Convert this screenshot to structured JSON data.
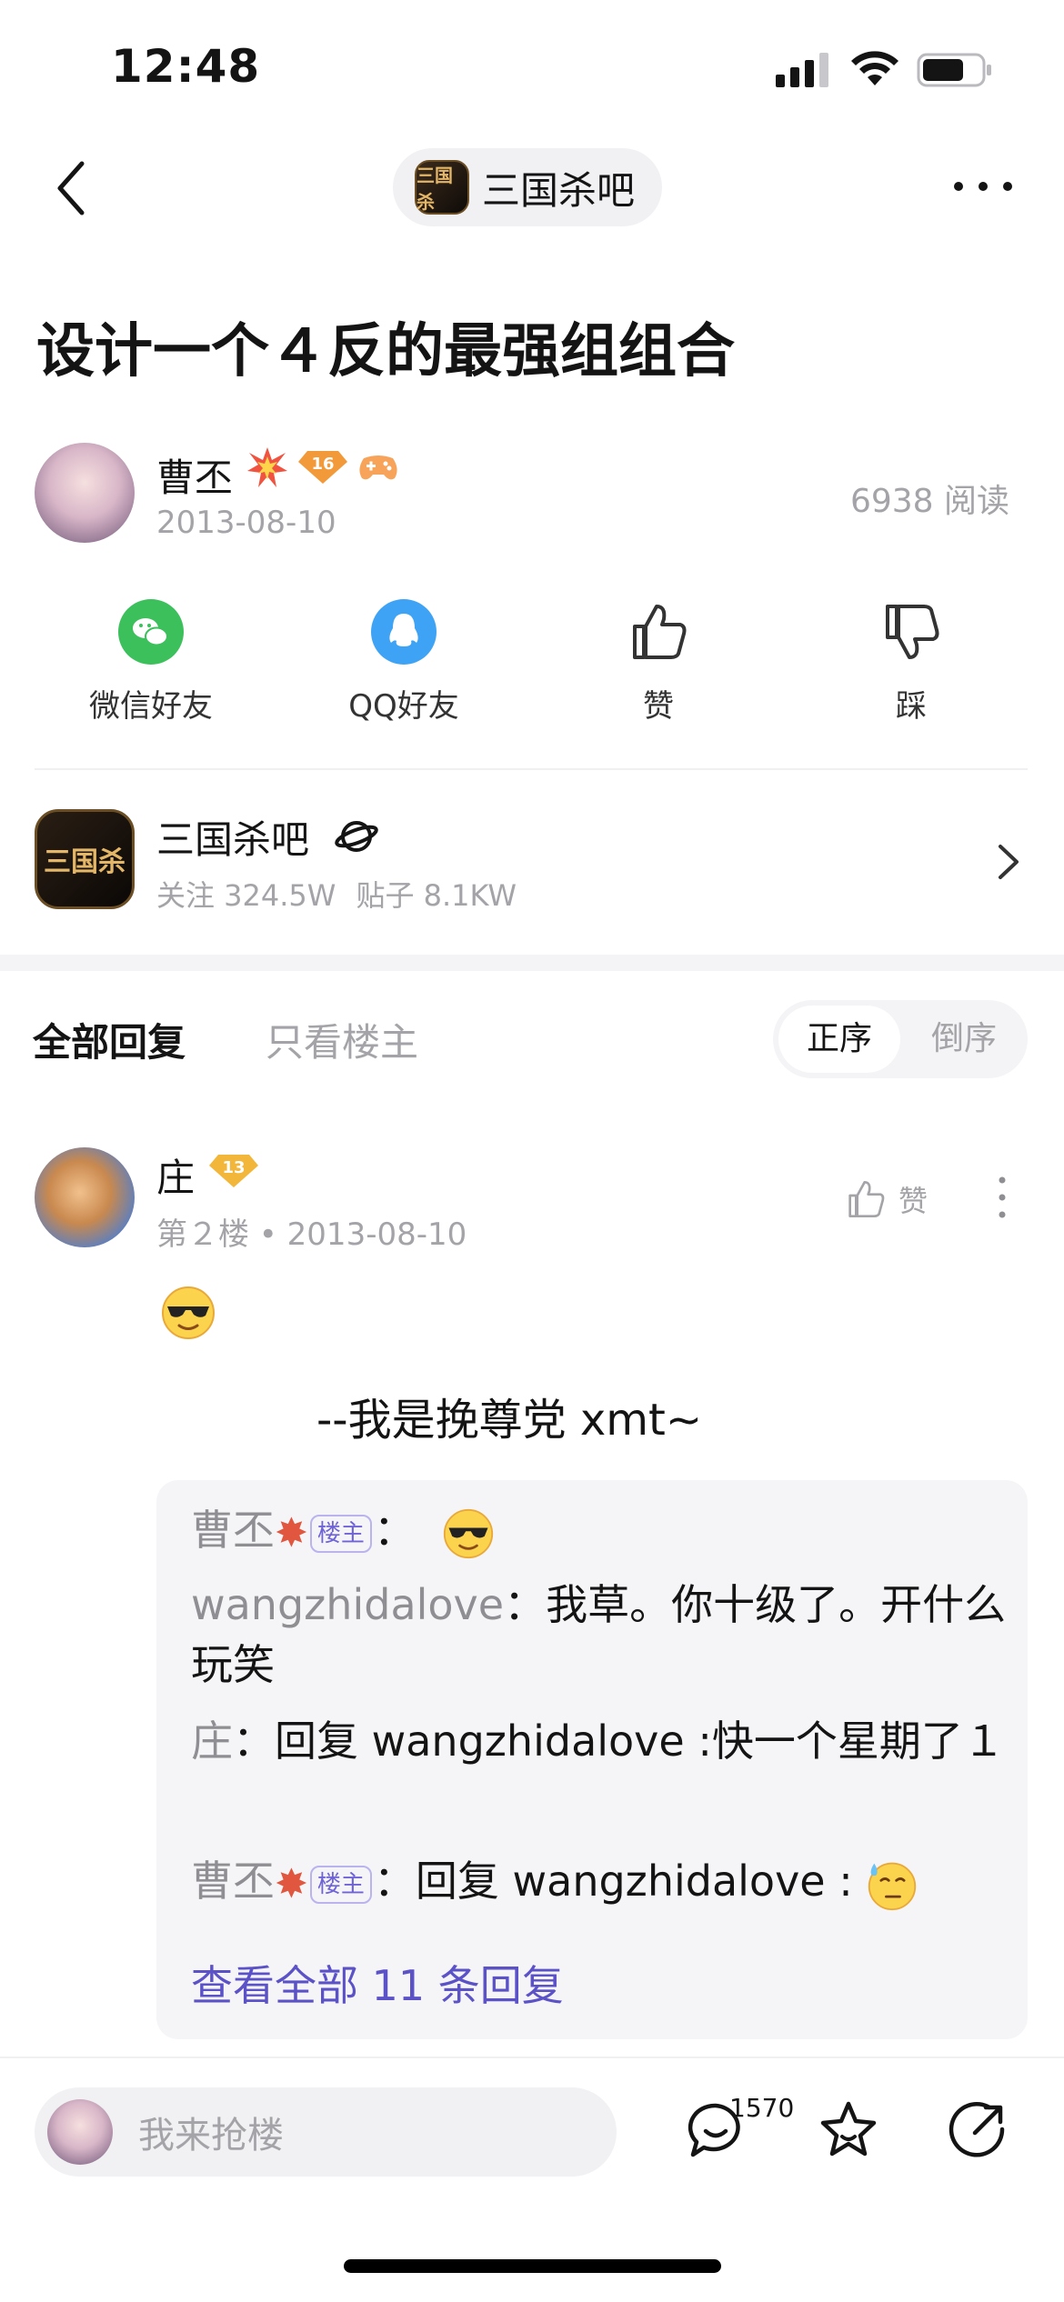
{
  "status": {
    "time": "12:48"
  },
  "nav": {
    "forum_name": "三国杀吧",
    "forum_logo_text": "三国杀"
  },
  "post": {
    "title": "设计一个４反的最强组组合",
    "author": "曹丕",
    "author_level": "16",
    "date": "2013-08-10",
    "read_count": "6938 阅读"
  },
  "share": [
    {
      "label": "微信好友",
      "icon": "wechat-icon",
      "color": "#3cc05c"
    },
    {
      "label": "QQ好友",
      "icon": "qq-icon",
      "color": "#3fa3f5"
    },
    {
      "label": "赞",
      "icon": "thumbs-up-icon"
    },
    {
      "label": "踩",
      "icon": "thumbs-down-icon"
    }
  ],
  "forum_card": {
    "name": "三国杀吧",
    "logo_text": "三国杀",
    "follow": "关注 324.5W",
    "posts": "贴子 8.1KW"
  },
  "tabs": {
    "all": "全部回复",
    "op_only": "只看楼主",
    "asc": "正序",
    "desc": "倒序"
  },
  "reply": {
    "author": "庄",
    "level": "13",
    "meta": "第２楼 • 2013-08-10",
    "like_label": "赞",
    "text": "--我是挽尊党 xmt~",
    "sub_replies": [
      {
        "name": "曹丕",
        "op_tag": "楼主",
        "sep": "：",
        "text": ""
      },
      {
        "name": "wangzhidalove",
        "sep": "：",
        "text": "我草。你十级了。开什么玩笑"
      },
      {
        "name": "庄",
        "sep": "：",
        "text": "回复 wangzhidalove :快一个星期了１"
      },
      {
        "name": "曹丕",
        "op_tag": "楼主",
        "sep": "：",
        "text": "回复 wangzhidalove :"
      }
    ],
    "view_all": "查看全部 11 条回复"
  },
  "bottom": {
    "placeholder": "我来抢楼",
    "comment_count": "1570"
  },
  "colors": {
    "link": "#5c52c8",
    "muted": "#a3a3a8",
    "op_tag": "#6e64d8"
  }
}
